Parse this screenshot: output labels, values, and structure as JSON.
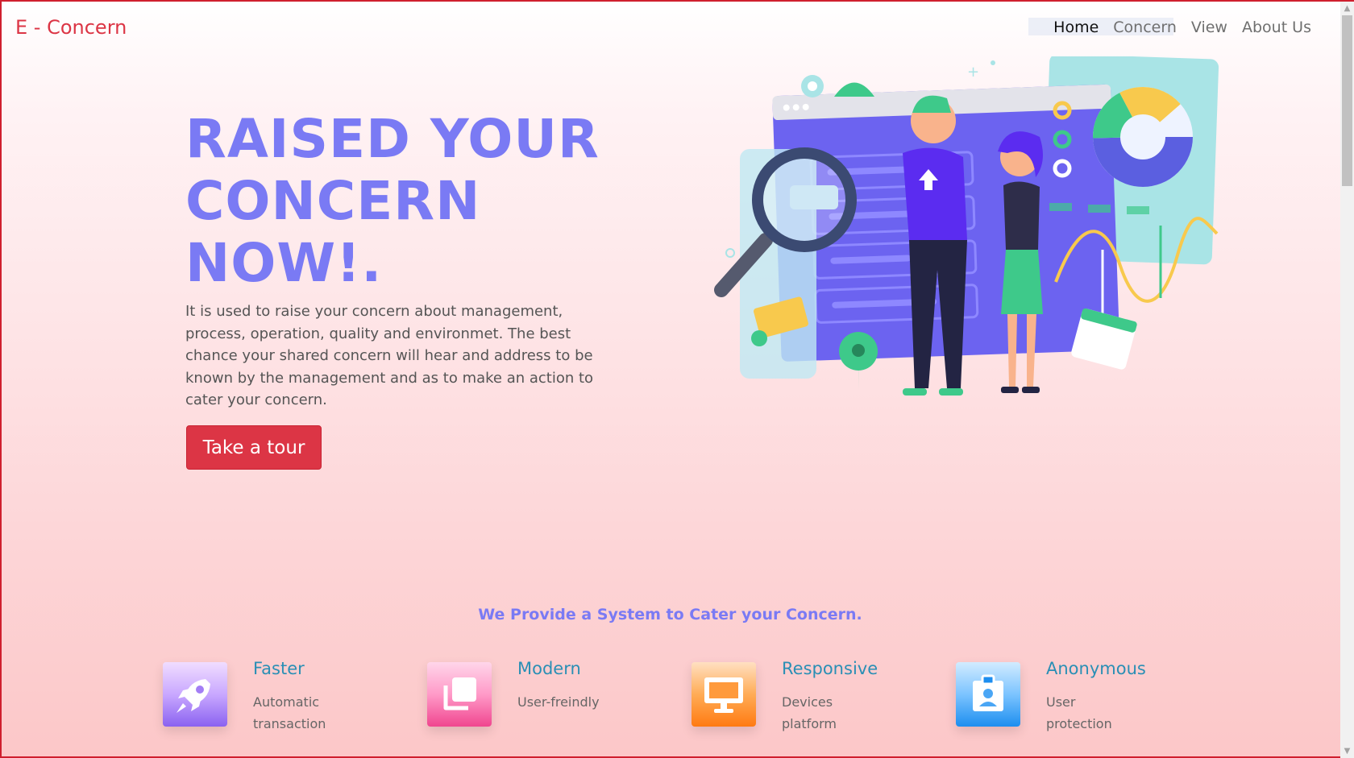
{
  "navbar": {
    "brand": "E - Concern",
    "links": [
      "Home",
      "Concern",
      "View",
      "About Us"
    ],
    "active": "Home"
  },
  "hero": {
    "title": "RAISED YOUR CONCERN NOW!.",
    "text": "It is used to raise your concern about management, process, operation, quality and environmet. The best chance your shared concern will hear and address to be known by the management and as to make an action to cater your concern.",
    "button_label": "Take a tour",
    "illustration": "analytics-team-illustration"
  },
  "services": {
    "title": "We Provide a System to Cater your Concern.",
    "features": [
      {
        "title": "Faster",
        "desc": "Automatic transaction",
        "icon": "rocket-icon",
        "color": "#8a62f0"
      },
      {
        "title": "Modern",
        "desc": "User-freindly",
        "icon": "layers-icon",
        "color": "#f0468f"
      },
      {
        "title": "Responsive",
        "desc": "Devices platform",
        "icon": "monitor-icon",
        "color": "#ff7a12"
      },
      {
        "title": "Anonymous",
        "desc": "User protection",
        "icon": "id-badge-icon",
        "color": "#1d8eef"
      }
    ]
  },
  "colors": {
    "brand": "#dc3545",
    "accent": "#7a7af4",
    "feature_title": "#2a8fb5"
  }
}
